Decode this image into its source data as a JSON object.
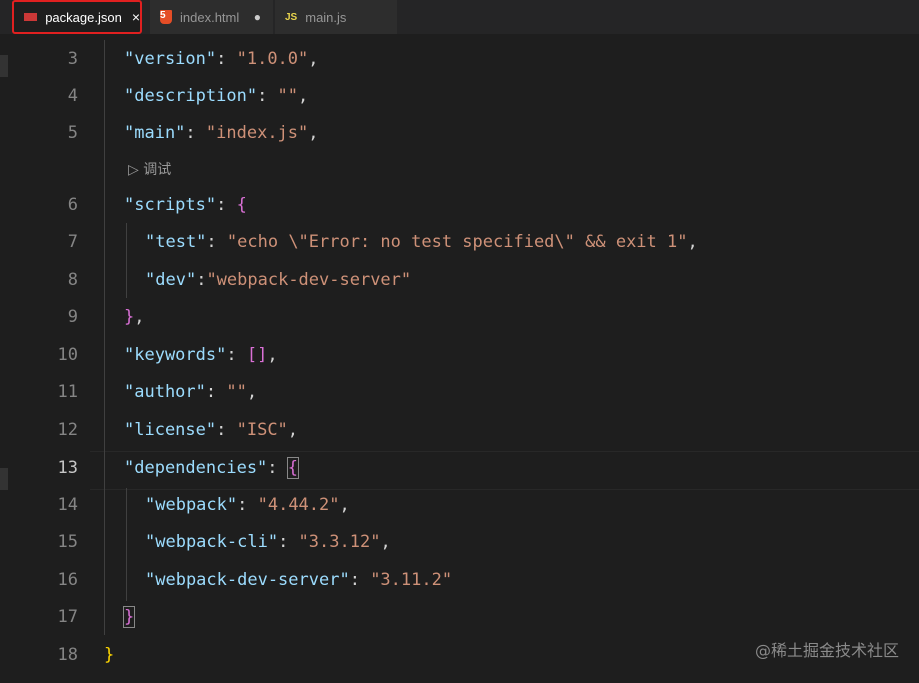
{
  "tabs": [
    {
      "label": "package.json",
      "icon": "npm-icon",
      "active": true,
      "close": "×"
    },
    {
      "label": "index.html",
      "icon": "html5-icon",
      "icon_text": "5",
      "modified_dot": "●"
    },
    {
      "label": "main.js",
      "icon": "js-icon",
      "icon_text": "JS"
    }
  ],
  "codelens": "▷ 调试",
  "lines": [
    {
      "num": "3"
    },
    {
      "num": "4"
    },
    {
      "num": "5"
    },
    {
      "num": "6"
    },
    {
      "num": "7"
    },
    {
      "num": "8"
    },
    {
      "num": "9"
    },
    {
      "num": "10"
    },
    {
      "num": "11"
    },
    {
      "num": "12"
    },
    {
      "num": "13"
    },
    {
      "num": "14"
    },
    {
      "num": "15"
    },
    {
      "num": "16"
    },
    {
      "num": "17"
    },
    {
      "num": "18"
    }
  ],
  "tokens": {
    "version_key": "\"version\"",
    "version_val": "\"1.0.0\"",
    "description_key": "\"description\"",
    "description_val": "\"\"",
    "main_key": "\"main\"",
    "main_val": "\"index.js\"",
    "scripts_key": "\"scripts\"",
    "test_key": "\"test\"",
    "test_val": "\"echo \\\"Error: no test specified\\\" && exit 1\"",
    "dev_key": "\"dev\"",
    "dev_val": "\"webpack-dev-server\"",
    "keywords_key": "\"keywords\"",
    "author_key": "\"author\"",
    "author_val": "\"\"",
    "license_key": "\"license\"",
    "license_val": "\"ISC\"",
    "dependencies_key": "\"dependencies\"",
    "webpack_key": "\"webpack\"",
    "webpack_val": "\"4.44.2\"",
    "webpack_cli_key": "\"webpack-cli\"",
    "webpack_cli_val": "\"3.3.12\"",
    "webpack_dev_server_key": "\"webpack-dev-server\"",
    "webpack_dev_server_val": "\"3.11.2\""
  },
  "watermark": "@稀土掘金技术社区",
  "colors": {
    "key": "#9cdcfe",
    "string": "#ce9178",
    "bracket1": "#ffd700",
    "bracket2": "#da70d6",
    "bracket3": "#179fff",
    "tab_highlight": "#e02020"
  }
}
